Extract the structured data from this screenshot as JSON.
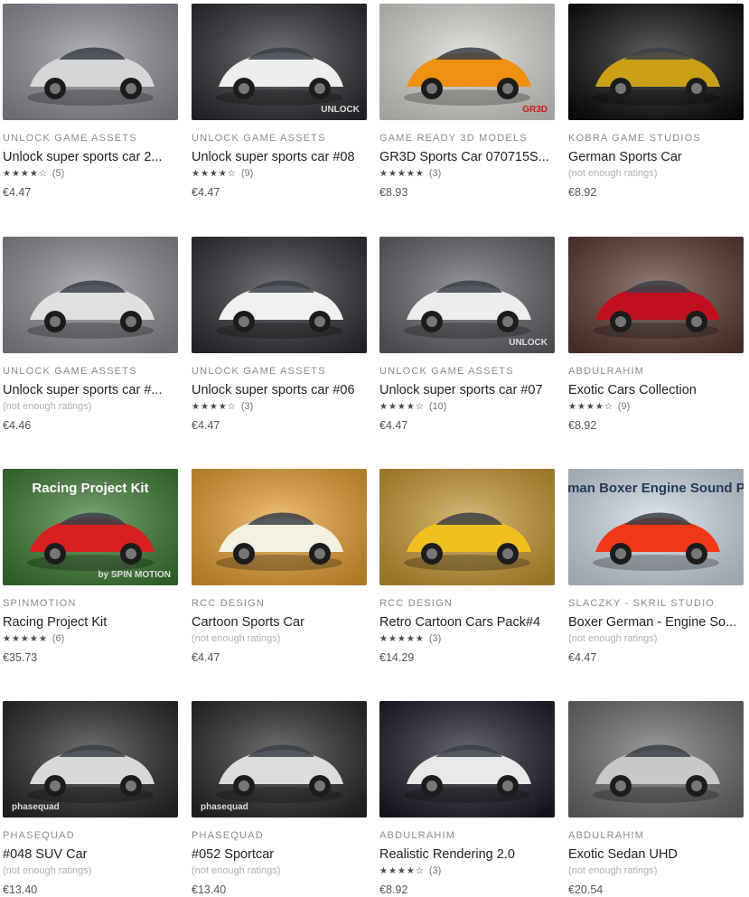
{
  "products": [
    {
      "publisher": "UNLOCK GAME ASSETS",
      "title": "Unlock super sports car 2...",
      "stars": "★★★★☆",
      "rating_text": "(5)",
      "price": "€4.47",
      "icon": "white-sports-car-gray-backdrop-image",
      "colors": {
        "bg": "#8e8f98",
        "car": "#d6d6d8"
      }
    },
    {
      "publisher": "UNLOCK GAME ASSETS",
      "title": "Unlock super sports car #08",
      "stars": "★★★★☆",
      "rating_text": "(9)",
      "price": "€4.47",
      "icon": "white-sports-car-dark-backdrop-image",
      "logo": "UNLOCK",
      "colors": {
        "bg": "#2b2a30",
        "car": "#eeeeee"
      }
    },
    {
      "publisher": "GAME READY 3D MODELS",
      "title": "GR3D Sports Car 070715S...",
      "stars": "★★★★★",
      "rating_text": "(3)",
      "price": "€8.93",
      "icon": "orange-sports-car-image",
      "logo": "GR3D",
      "colors": {
        "bg": "#d8d8d2",
        "car": "#f09010"
      }
    },
    {
      "publisher": "KOBRA GAME STUDIOS",
      "title": "German Sports Car",
      "stars": "",
      "rating_text": "(not enough ratings)",
      "price": "€8.92",
      "icon": "yellow-sports-car-image",
      "colors": {
        "bg": "#0c0c0c",
        "car": "#c9a018"
      }
    },
    {
      "publisher": "UNLOCK GAME ASSETS",
      "title": "Unlock super sports car #...",
      "stars": "",
      "rating_text": "(not enough ratings)",
      "price": "€4.46",
      "icon": "white-roadster-image",
      "colors": {
        "bg": "#8a8a92",
        "car": "#e0e0e0"
      }
    },
    {
      "publisher": "UNLOCK GAME ASSETS",
      "title": "Unlock super sports car #06",
      "stars": "★★★★☆",
      "rating_text": "(3)",
      "price": "€4.47",
      "icon": "white-coupe-image",
      "colors": {
        "bg": "#2d2d33",
        "car": "#f0f0f0"
      }
    },
    {
      "publisher": "UNLOCK GAME ASSETS",
      "title": "Unlock super sports car #07",
      "stars": "★★★★☆",
      "rating_text": "(10)",
      "price": "€4.47",
      "icon": "white-hybrid-car-image",
      "logo": "UNLOCK",
      "colors": {
        "bg": "#606068",
        "car": "#ececec"
      }
    },
    {
      "publisher": "ABDULRAHIM",
      "title": "Exotic Cars Collection",
      "stars": "★★★★☆",
      "rating_text": "(9)",
      "price": "€8.92",
      "icon": "red-exotic-car-sunset-image",
      "colors": {
        "bg": "#5a3a30",
        "car": "#c01020"
      }
    },
    {
      "publisher": "SPINMOTION",
      "title": "Racing Project Kit",
      "stars": "★★★★★",
      "rating_text": "(6)",
      "price": "€35.73",
      "icon": "racing-kit-cartoon-cars-image",
      "banner": "Racing Project Kit",
      "logo": "by SPIN MOTION",
      "colors": {
        "bg": "#3a7a30",
        "car": "#d82020"
      }
    },
    {
      "publisher": "RCC DESIGN",
      "title": "Cartoon Sports Car",
      "stars": "",
      "rating_text": "(not enough ratings)",
      "price": "€4.47",
      "icon": "cartoon-white-sports-car-image",
      "colors": {
        "bg": "#e8a030",
        "car": "#f4f0e0"
      }
    },
    {
      "publisher": "RCC DESIGN",
      "title": "Retro Cartoon Cars Pack#4",
      "stars": "★★★★★",
      "rating_text": "(3)",
      "price": "€14.29",
      "icon": "retro-cartoon-cars-image",
      "colors": {
        "bg": "#c89830",
        "car": "#f0c020"
      }
    },
    {
      "publisher": "SLACZKY - SKRIL STUDIO",
      "title": "Boxer German - Engine So...",
      "stars": "",
      "rating_text": "(not enough ratings)",
      "price": "€4.47",
      "icon": "engine-sound-pack-image",
      "banner": "German Boxer Engine Sound Pack",
      "colors": {
        "bg": "#d0dce8",
        "car": "#f03818"
      }
    },
    {
      "publisher": "PHASEQUAD",
      "title": "#048 SUV Car",
      "stars": "",
      "rating_text": "(not enough ratings)",
      "price": "€13.40",
      "icon": "silver-suv-image",
      "logo": "phasequad",
      "colors": {
        "bg": "#262626",
        "car": "#d8d8d8"
      }
    },
    {
      "publisher": "PHASEQUAD",
      "title": "#052 Sportcar",
      "stars": "",
      "rating_text": "(not enough ratings)",
      "price": "€13.40",
      "icon": "silver-sportcar-image",
      "logo": "phasequad",
      "colors": {
        "bg": "#262626",
        "car": "#dcdcdc"
      }
    },
    {
      "publisher": "ABDULRAHIM",
      "title": "Realistic Rendering 2.0",
      "stars": "★★★★☆",
      "rating_text": "(3)",
      "price": "€8.92",
      "icon": "realistic-render-car-image",
      "colors": {
        "bg": "#1a1a28",
        "car": "#e8e8ea"
      }
    },
    {
      "publisher": "ABDULRAHIM",
      "title": "Exotic Sedan UHD",
      "stars": "",
      "rating_text": "(not enough ratings)",
      "price": "€20.54",
      "icon": "silver-sedan-uhd-image",
      "colors": {
        "bg": "#6a6a6a",
        "car": "#c8c8c8"
      }
    }
  ]
}
